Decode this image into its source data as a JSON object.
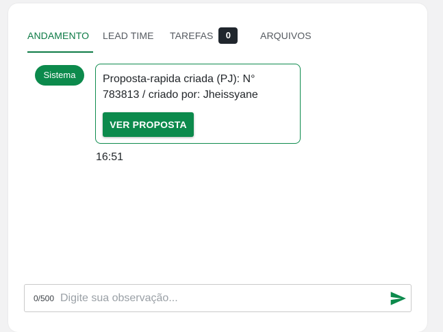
{
  "tabs": [
    {
      "label": "ANDAMENTO",
      "active": true
    },
    {
      "label": "LEAD TIME",
      "active": false
    },
    {
      "label": "TAREFAS",
      "active": false,
      "badge": "0"
    },
    {
      "label": "ARQUIVOS",
      "active": false
    }
  ],
  "message": {
    "sender": "Sistema",
    "text": "Proposta-rapida criada (PJ): N° 783813 / criado por: Jheissyane",
    "button_label": "VER PROPOSTA",
    "time": "16:51"
  },
  "composer": {
    "counter": "0/500",
    "placeholder": "Digite sua observação...",
    "send_icon": "send-icon"
  },
  "colors": {
    "accent": "#0c8a4c",
    "badge_bg": "#20262d"
  }
}
